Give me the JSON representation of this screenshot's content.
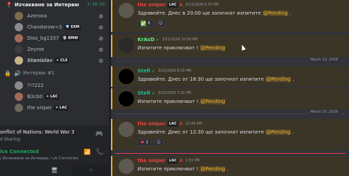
{
  "voice_channel": {
    "title": "Изчакване за Интервю",
    "timer": "1:30:43",
    "users": [
      {
        "name": "Azeroxa",
        "badge": ""
      },
      {
        "name": "Chavdarow<3",
        "badge": "💎 EXM"
      },
      {
        "name": "Diso_bg1337",
        "badge": "🛡 BMW"
      },
      {
        "name": "Zeyrox",
        "badge": ""
      },
      {
        "name": "Stanislav",
        "badge": "✦ CLS"
      }
    ]
  },
  "voice_channel_2": {
    "title": "Интервю #1",
    "users": [
      {
        "name": "?!?222",
        "badge": ""
      },
      {
        "name": "B3cb0",
        "badge": "✦ LAC"
      },
      {
        "name": "the sniper",
        "badge": "✦ LAC"
      }
    ]
  },
  "activity": {
    "game": "onflict of Nations: World War 3",
    "subtitle": "d Sharing"
  },
  "voice_status": {
    "title": "ice Connected",
    "subtitle": "| Изчакване за Интервю / LA Chronicles"
  },
  "messages": [
    {
      "author": "the sniper",
      "tag": "LAC",
      "time": "3/11/2026 5:37 PM",
      "text": "Здравейте. Днес в 20:00 ще започнат изпитите",
      "mention": "@Pending",
      "suffix": ".",
      "reaction_emoji": "✅",
      "reaction_count": "6",
      "add": "☺"
    },
    {
      "author": "KrAsD",
      "time": "3/11/2026 10:00 PM",
      "text": "Изпитите приключват ! ",
      "mention": "@Pending",
      "suffix": ""
    },
    {
      "author": "Stefi",
      "time": "3/13/2026 6:15 PM",
      "text": "Здравейте. Днес от 18:30 ще започнат изпитите",
      "mention": "@Pending",
      "suffix": "."
    },
    {
      "author": "Stefi",
      "time": "3/13/2026 7:32 PM",
      "text": "Изпитите приключват ! ",
      "mention": "@Pending",
      "suffix": ""
    },
    {
      "author": "the sniper",
      "tag": "LAC",
      "time": "11:44 AM",
      "text": "Здравейте. Днес от 12:30 ще започнат изпитите",
      "mention": "@Pending",
      "suffix": ".",
      "reaction_emoji": "❤",
      "reaction_count": "2",
      "add": "☺"
    },
    {
      "author": "the sniper",
      "tag": "LAC",
      "time": "1:53 PM",
      "text": "Изпитите приключват ! ",
      "mention": "@Pending",
      "suffix": "."
    }
  ],
  "dividers": [
    "March 13, 2026",
    "March 15, 2026"
  ],
  "colors": {
    "accent_mention": "#f0b232",
    "author_red": "#f23f42",
    "author_green": "#57f287",
    "author_teal": "#1abc9c"
  },
  "icons": [
    "location-pin-icon",
    "mic-muted-icon",
    "lock-icon",
    "speaker-icon",
    "gamepad-icon",
    "signal-icon",
    "hangup-icon",
    "screen-icon",
    "grid-icon"
  ]
}
